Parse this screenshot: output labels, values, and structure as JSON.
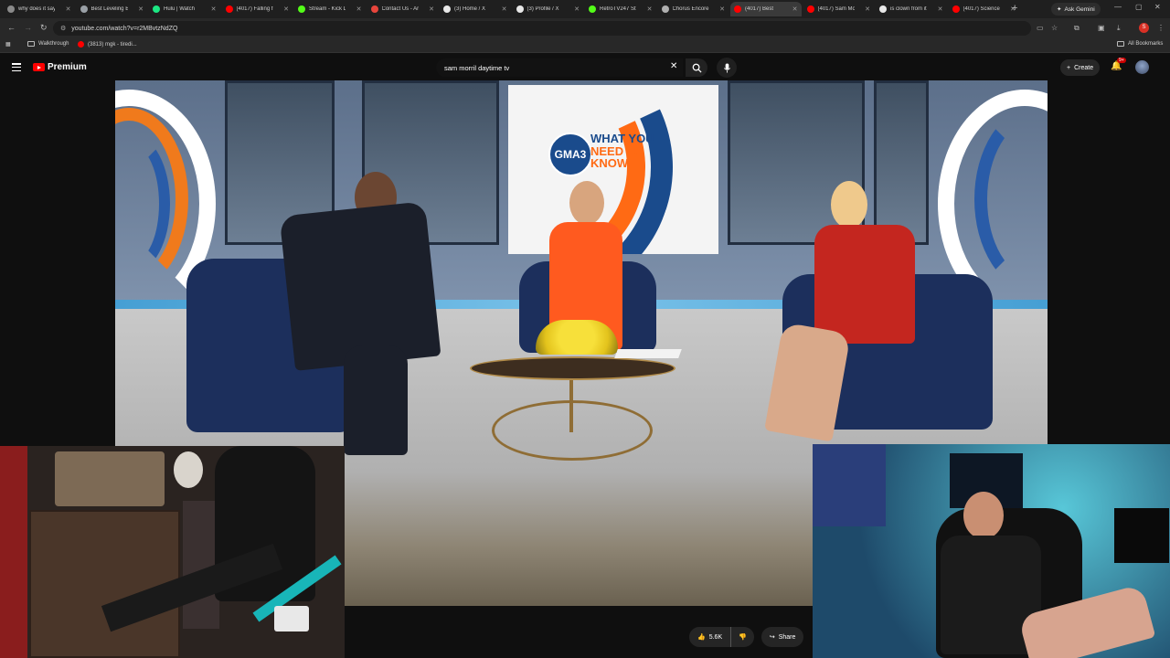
{
  "browser": {
    "tabs": [
      {
        "title": "why does it say",
        "color": "#8a8a8a"
      },
      {
        "title": "Best Leveling B",
        "color": "#9aa0a6"
      },
      {
        "title": "Hulu | Watch",
        "color": "#1ce783"
      },
      {
        "title": "(4017) Falling fr",
        "color": "#ff0000"
      },
      {
        "title": "Stream - Kick D",
        "color": "#53fc18"
      },
      {
        "title": "Contact Us - Ar",
        "color": "#e8453c"
      },
      {
        "title": "(3) Home / X",
        "color": "#e8e8e8"
      },
      {
        "title": "(3) Profile / X",
        "color": "#e8e8e8"
      },
      {
        "title": "RetroTV247 Stre",
        "color": "#53fc18"
      },
      {
        "title": "Chorus Encore",
        "color": "#b0b0b0"
      },
      {
        "title": "(4017) Best",
        "color": "#ff0000"
      },
      {
        "title": "(4017) Sam Mo",
        "color": "#ff0000"
      },
      {
        "title": "is clown from it",
        "color": "#e8e8e8"
      },
      {
        "title": "(4017) Science",
        "color": "#ff0000"
      }
    ],
    "active_tab_index": 10,
    "ask_gemini_label": "Ask Gemini",
    "url": "youtube.com/watch?v=r2MBvtzNdZQ",
    "bookmarks": [
      {
        "label": "Walkthrough"
      },
      {
        "label": "(3813) mgk - tiredi..."
      }
    ],
    "all_bookmarks_label": "All Bookmarks",
    "profile_initial": "S"
  },
  "youtube": {
    "logo_text": "Premium",
    "search_query": "sam morril daytime tv",
    "create_label": "Create",
    "notification_count": "9+"
  },
  "video": {
    "screen_badge": "GMA3",
    "screen_line1": "WHAT YOU",
    "screen_line2": "NEED TO",
    "screen_line3": "KNOW"
  },
  "actions": {
    "like_count": "5.6K",
    "share_label": "Share"
  },
  "colors": {
    "youtube_red": "#ff0000",
    "page_bg": "#0f0f0f",
    "chair_blue": "#1c2f5c"
  }
}
